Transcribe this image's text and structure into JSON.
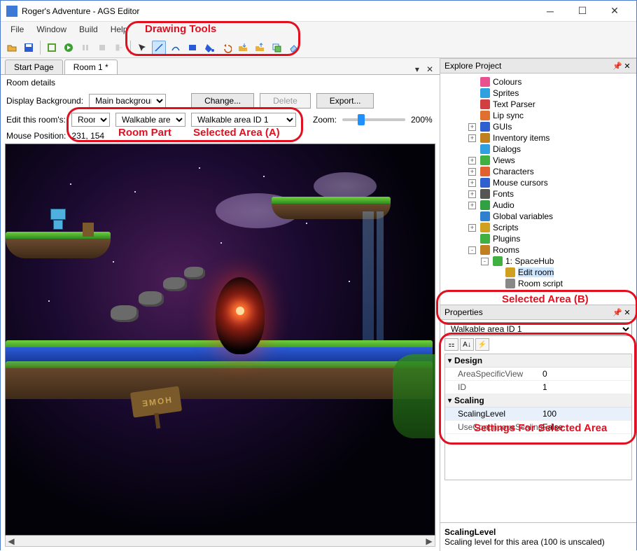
{
  "window": {
    "title": "Roger's Adventure - AGS Editor"
  },
  "menu": {
    "items": [
      "File",
      "Window",
      "Build",
      "Help"
    ]
  },
  "tabs": {
    "start": "Start Page",
    "room": "Room 1 *"
  },
  "room": {
    "header": "Room details",
    "display_bg_label": "Display Background:",
    "display_bg_value": "Main background",
    "change": "Change...",
    "delete": "Delete",
    "export": "Export...",
    "edit_label": "Edit this room's:",
    "part": "Room",
    "area_type": "Walkable areas",
    "selected_area": "Walkable area ID 1",
    "zoom_label": "Zoom:",
    "zoom_value": "200%",
    "mouse_label": "Mouse Position:",
    "mouse_value": "231, 154",
    "sign_text": "HOME"
  },
  "explore": {
    "title": "Explore Project",
    "nodes": [
      {
        "label": "Colours",
        "indent": 2,
        "icon": "palette"
      },
      {
        "label": "Sprites",
        "indent": 2,
        "icon": "sprite"
      },
      {
        "label": "Text Parser",
        "indent": 2,
        "icon": "parser"
      },
      {
        "label": "Lip sync",
        "indent": 2,
        "icon": "lipsync"
      },
      {
        "label": "GUIs",
        "indent": 2,
        "icon": "gui",
        "exp": "+"
      },
      {
        "label": "Inventory items",
        "indent": 2,
        "icon": "inv",
        "exp": "+"
      },
      {
        "label": "Dialogs",
        "indent": 2,
        "icon": "dialog"
      },
      {
        "label": "Views",
        "indent": 2,
        "icon": "view",
        "exp": "+"
      },
      {
        "label": "Characters",
        "indent": 2,
        "icon": "char",
        "exp": "+"
      },
      {
        "label": "Mouse cursors",
        "indent": 2,
        "icon": "cursor",
        "exp": "+"
      },
      {
        "label": "Fonts",
        "indent": 2,
        "icon": "font",
        "exp": "+"
      },
      {
        "label": "Audio",
        "indent": 2,
        "icon": "audio",
        "exp": "+"
      },
      {
        "label": "Global variables",
        "indent": 2,
        "icon": "globe"
      },
      {
        "label": "Scripts",
        "indent": 2,
        "icon": "script",
        "exp": "+"
      },
      {
        "label": "Plugins",
        "indent": 2,
        "icon": "plugin"
      },
      {
        "label": "Rooms",
        "indent": 2,
        "icon": "rooms",
        "exp": "-"
      },
      {
        "label": "1: SpaceHub",
        "indent": 3,
        "icon": "room",
        "exp": "-"
      },
      {
        "label": "Edit room",
        "indent": 4,
        "icon": "edit",
        "sel": true
      },
      {
        "label": "Room script",
        "indent": 4,
        "icon": "script2"
      }
    ]
  },
  "properties": {
    "title": "Properties",
    "selector": "Walkable area ID 1",
    "cats": [
      {
        "name": "Design",
        "rows": [
          {
            "k": "AreaSpecificView",
            "v": "0"
          },
          {
            "k": "ID",
            "v": "1"
          }
        ]
      },
      {
        "name": "Scaling",
        "rows": [
          {
            "k": "ScalingLevel",
            "v": "100",
            "sel": true
          },
          {
            "k": "UseContinuousScaling",
            "v": "False"
          }
        ]
      }
    ],
    "desc_name": "ScalingLevel",
    "desc_text": "Scaling level for this area (100 is unscaled)"
  },
  "annotations": {
    "drawing": "Drawing Tools",
    "roompart": "Room Part",
    "sel_a": "Selected Area (A)",
    "sel_b": "Selected Area (B)",
    "settings": "Settings For Selected Area"
  }
}
